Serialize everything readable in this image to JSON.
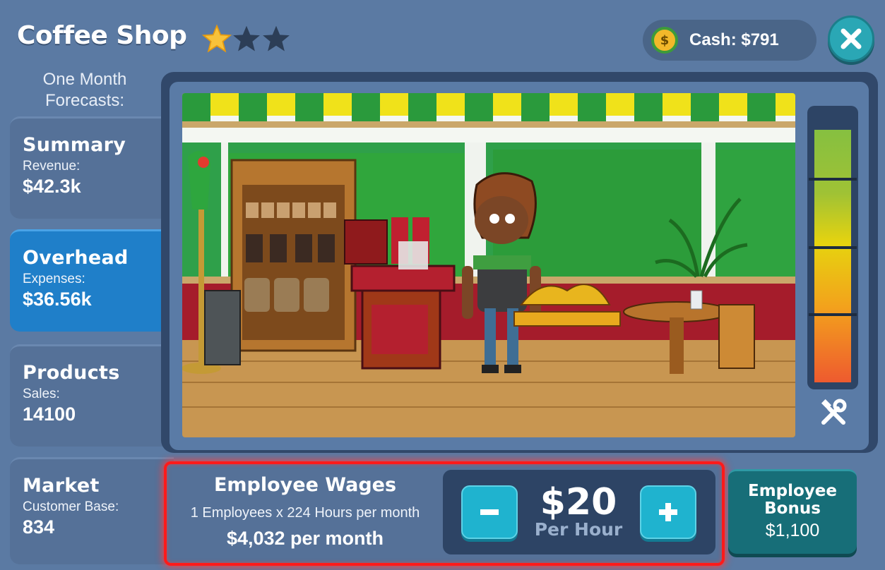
{
  "header": {
    "title": "Coffee Shop",
    "stars_filled": 1,
    "stars_total": 3,
    "cash_label": "Cash: $791"
  },
  "sidebar": {
    "forecast_label": "One Month Forecasts:",
    "tabs": [
      {
        "title": "Summary",
        "sub": "Revenue:",
        "value": "$42.3k"
      },
      {
        "title": "Overhead",
        "sub": "Expenses:",
        "value": "$36.56k"
      },
      {
        "title": "Products",
        "sub": "Sales:",
        "value": "14100"
      },
      {
        "title": "Market",
        "sub": "Customer Base:",
        "value": "834"
      }
    ]
  },
  "wages": {
    "title": "Employee Wages",
    "subtitle": "1 Employees x 224 Hours per month",
    "total": "$4,032 per month",
    "value": "$20",
    "unit": "Per Hour",
    "minus": "-",
    "plus": "+"
  },
  "bonus": {
    "title": "Employee Bonus",
    "value": "$1,100"
  },
  "colors": {
    "background": "#5b7aa3",
    "active_tab": "#1f7fc9",
    "accent_button": "#1fb3cf",
    "highlight": "#ff1a1a"
  }
}
